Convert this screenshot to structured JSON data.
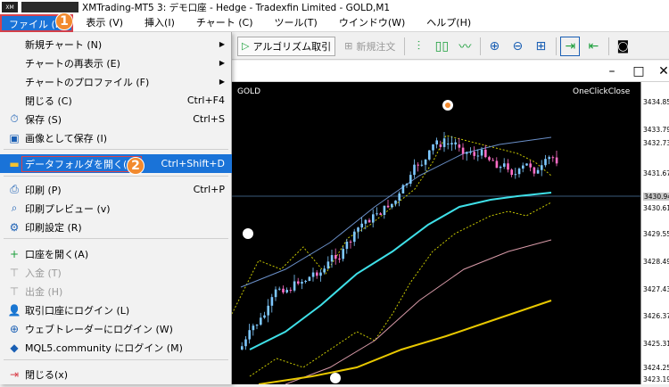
{
  "window": {
    "logo": "XM",
    "title": "XMTrading-MT5 3: デモ口座 - Hedge - Tradexfin Limited - GOLD,M1"
  },
  "menubar": {
    "items": [
      "ファイル (F)",
      "表示 (V)",
      "挿入(I)",
      "チャート (C)",
      "ツール(T)",
      "ウインドウ(W)",
      "ヘルプ(H)"
    ]
  },
  "badges": {
    "one": "1",
    "two": "2"
  },
  "toolbar": {
    "algo_label": "アルゴリズム取引",
    "new_order_label": "新規注文"
  },
  "chart": {
    "symbol": "GOLD",
    "oneclick": "OneClickClose",
    "current_price": "3430.94",
    "price_labels": [
      "3434.85",
      "3433.79",
      "3432.73",
      "3431.67",
      "3430.61",
      "3429.55",
      "3428.49",
      "3427.43",
      "3426.37",
      "3425.31",
      "3424.25",
      "3423.19"
    ]
  },
  "file_menu": {
    "new_chart": "新規チャート (N)",
    "redisplay": "チャートの再表示 (E)",
    "profile": "チャートのプロファイル (F)",
    "close": "閉じる (C)",
    "close_sc": "Ctrl+F4",
    "save": "保存 (S)",
    "save_sc": "Ctrl+S",
    "save_image": "画像として保存 (I)",
    "open_data": "データフォルダを開く(D)",
    "open_data_sc": "Ctrl+Shift+D",
    "print": "印刷 (P)",
    "print_sc": "Ctrl+P",
    "preview": "印刷プレビュー (v)",
    "print_setup": "印刷設定 (R)",
    "open_account": "口座を開く(A)",
    "deposit": "入金 (T)",
    "withdraw": "出金 (H)",
    "login_trade": "取引口座にログイン (L)",
    "login_web": "ウェブトレーダーにログイン (W)",
    "login_mql": "MQL5.community にログイン (M)",
    "exit": "閉じる(x)"
  }
}
